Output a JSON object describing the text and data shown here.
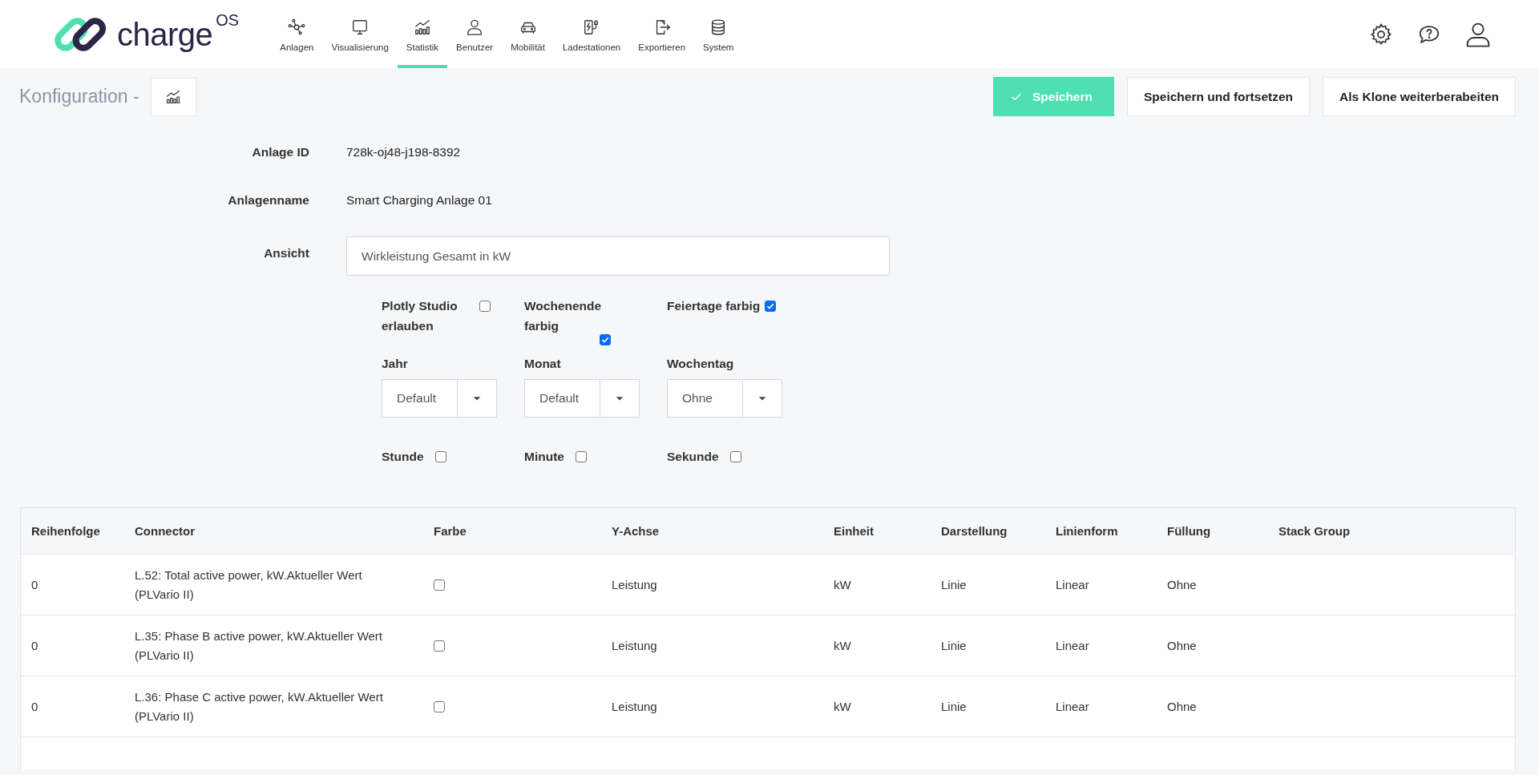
{
  "header": {
    "logo": {
      "name": "charge",
      "suffix": "OS"
    },
    "nav": [
      {
        "label": "Anlagen",
        "kind": "network",
        "selected": false
      },
      {
        "label": "Visualisierung",
        "kind": "monitor",
        "selected": false
      },
      {
        "label": "Statistik",
        "kind": "chart",
        "selected": true
      },
      {
        "label": "Benutzer",
        "kind": "user",
        "selected": false
      },
      {
        "label": "Mobilität",
        "kind": "car",
        "selected": false
      },
      {
        "label": "Ladestationen",
        "kind": "charger",
        "selected": false
      },
      {
        "label": "Exportieren",
        "kind": "export",
        "selected": false
      },
      {
        "label": "System",
        "kind": "database",
        "selected": false
      }
    ]
  },
  "toolbar": {
    "title": "Konfiguration -",
    "buttons": [
      {
        "label": "Speichern",
        "kind": "primary"
      },
      {
        "label": "Speichern und fortsetzen",
        "kind": "secondary"
      },
      {
        "label": "Als Klone weiterberabeiten",
        "kind": "secondary"
      }
    ]
  },
  "form": {
    "fields": [
      {
        "label": "Anlage ID",
        "value": "728k-oj48-j198-8392"
      },
      {
        "label": "Anlagenname",
        "value": "Smart Charging Anlage 01"
      }
    ],
    "view": {
      "label": "Ansicht",
      "value": "Wirkleistung Gesamt in kW"
    },
    "options": [
      {
        "label": "Plotly Studio erlauben",
        "checked": false
      },
      {
        "label": "Wochenende farbig",
        "checked": true
      },
      {
        "label": "Feiertage farbig",
        "checked": true
      }
    ],
    "selects": [
      {
        "label": "Jahr",
        "value": "Default"
      },
      {
        "label": "Monat",
        "value": "Default"
      },
      {
        "label": "Wochentag",
        "value": "Ohne"
      }
    ],
    "time_options": [
      {
        "label": "Stunde",
        "checked": false
      },
      {
        "label": "Minute",
        "checked": false
      },
      {
        "label": "Sekunde",
        "checked": false
      }
    ]
  },
  "table": {
    "columns": [
      "Reihenfolge",
      "Connector",
      "Farbe",
      "Y-Achse",
      "Einheit",
      "Darstellung",
      "Linienform",
      "Füllung",
      "Stack Group"
    ],
    "rows": [
      {
        "order": "0",
        "connector": "L.52: Total active power, kW.Aktueller Wert (PLVario II)",
        "color_checked": false,
        "y_axis": "Leistung",
        "unit": "kW",
        "display": "Linie",
        "line_shape": "Linear",
        "fill": "Ohne"
      },
      {
        "order": "0",
        "connector": "L.35: Phase B active power, kW.Aktueller Wert (PLVario II)",
        "color_checked": false,
        "y_axis": "Leistung",
        "unit": "kW",
        "display": "Linie",
        "line_shape": "Linear",
        "fill": "Ohne"
      },
      {
        "order": "0",
        "connector": "L.36: Phase C active power, kW.Aktueller Wert (PLVario II)",
        "color_checked": false,
        "y_axis": "Leistung",
        "unit": "kW",
        "display": "Linie",
        "line_shape": "Linear",
        "fill": "Ohne"
      }
    ]
  }
}
